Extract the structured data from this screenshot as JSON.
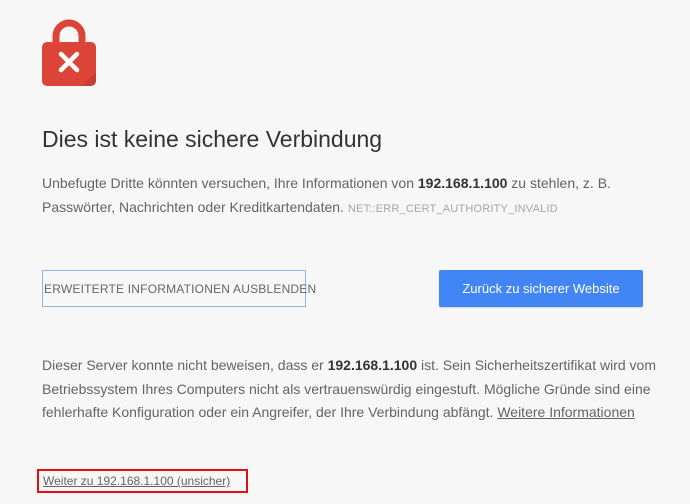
{
  "page": {
    "title": "Dies ist keine sichere Verbindung",
    "summary_before": "Unbefugte Dritte könnten versuchen, Ihre Informationen von ",
    "host": "192.168.1.100",
    "summary_after": " zu stehlen, z. B. Passwörter, Nachrichten oder Kreditkartendaten. ",
    "error_code": "NET::ERR_CERT_AUTHORITY_INVALID",
    "icon": "lock-error-icon",
    "icon_color": "#db4437"
  },
  "buttons": {
    "details_label": "ERWEITERTE INFORMATIONEN AUSBLENDEN",
    "back_label": "Zurück zu sicherer Website",
    "back_color": "#4285f4"
  },
  "details": {
    "text_before": "Dieser Server konnte nicht beweisen, dass er ",
    "host": "192.168.1.100",
    "text_after": " ist. Sein Sicherheitszertifikat wird vom Betriebssystem Ihres Computers nicht als vertrauenswürdig eingestuft. Mögliche Gründe sind eine fehlerhafte Konfiguration oder ein Angreifer, der Ihre Verbindung abfängt. ",
    "learn_more": "Weitere Informationen",
    "proceed_link": "Weiter zu 192.168.1.100 (unsicher)",
    "highlight_color": "#e01010"
  }
}
